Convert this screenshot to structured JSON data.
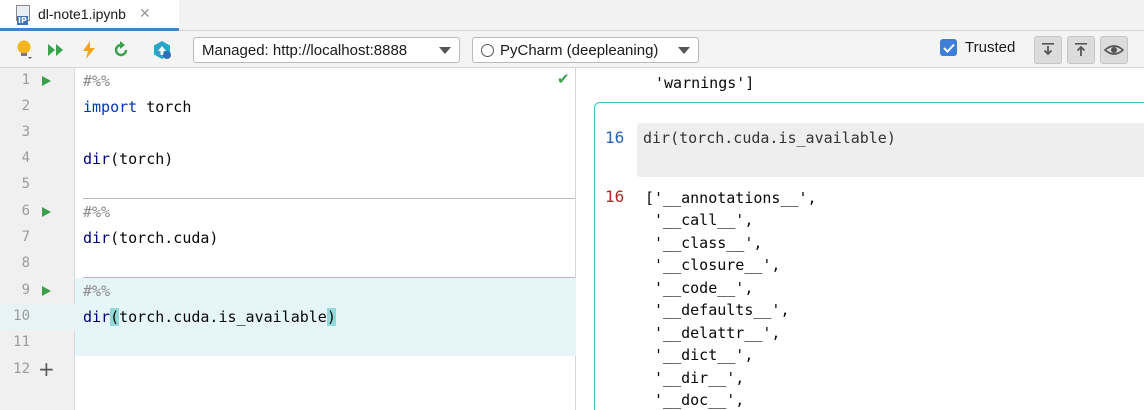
{
  "tab": {
    "title": "dl-note1.ipynb",
    "close": "✕",
    "icon": "ipynb-file-icon"
  },
  "toolbar": {
    "server_select": "Managed: http://localhost:8888",
    "kernel_select": "PyCharm (deepleaning)",
    "trusted_label": "Trusted",
    "trusted_checked": true
  },
  "gutter": {
    "lines": [
      "1",
      "2",
      "3",
      "4",
      "5",
      "6",
      "7",
      "8",
      "9",
      "10",
      "11",
      "12"
    ]
  },
  "editor": {
    "lines": [
      {
        "text": "#%%"
      },
      {
        "kw": "import",
        "rest": " torch"
      },
      {
        "text": ""
      },
      {
        "fn": "dir",
        "rest": "(torch)"
      },
      {
        "text": ""
      },
      {
        "text": "#%%"
      },
      {
        "fn": "dir",
        "rest": "(torch.cuda)"
      },
      {
        "text": ""
      },
      {
        "text": "#%%"
      },
      {
        "fn": "dir",
        "open": "(",
        "mid": "torch.cuda.is_available",
        "close": ")"
      },
      {
        "text": ""
      }
    ]
  },
  "output": {
    "previous_tail": "'warnings']",
    "in_number": "16",
    "in_code": "dir(torch.cuda.is_available)",
    "out_number": "16",
    "out_lines": [
      "['__annotations__',",
      " '__call__',",
      " '__class__',",
      " '__closure__',",
      " '__code__',",
      " '__defaults__',",
      " '__delattr__',",
      " '__dict__',",
      " '__dir__',",
      " '__doc__',"
    ]
  },
  "colors": {
    "accent": "#4083c9",
    "run": "#3b9f4b",
    "in_num": "#2864b4",
    "out_num": "#a52a2a",
    "card_border": "#48b8c9"
  }
}
